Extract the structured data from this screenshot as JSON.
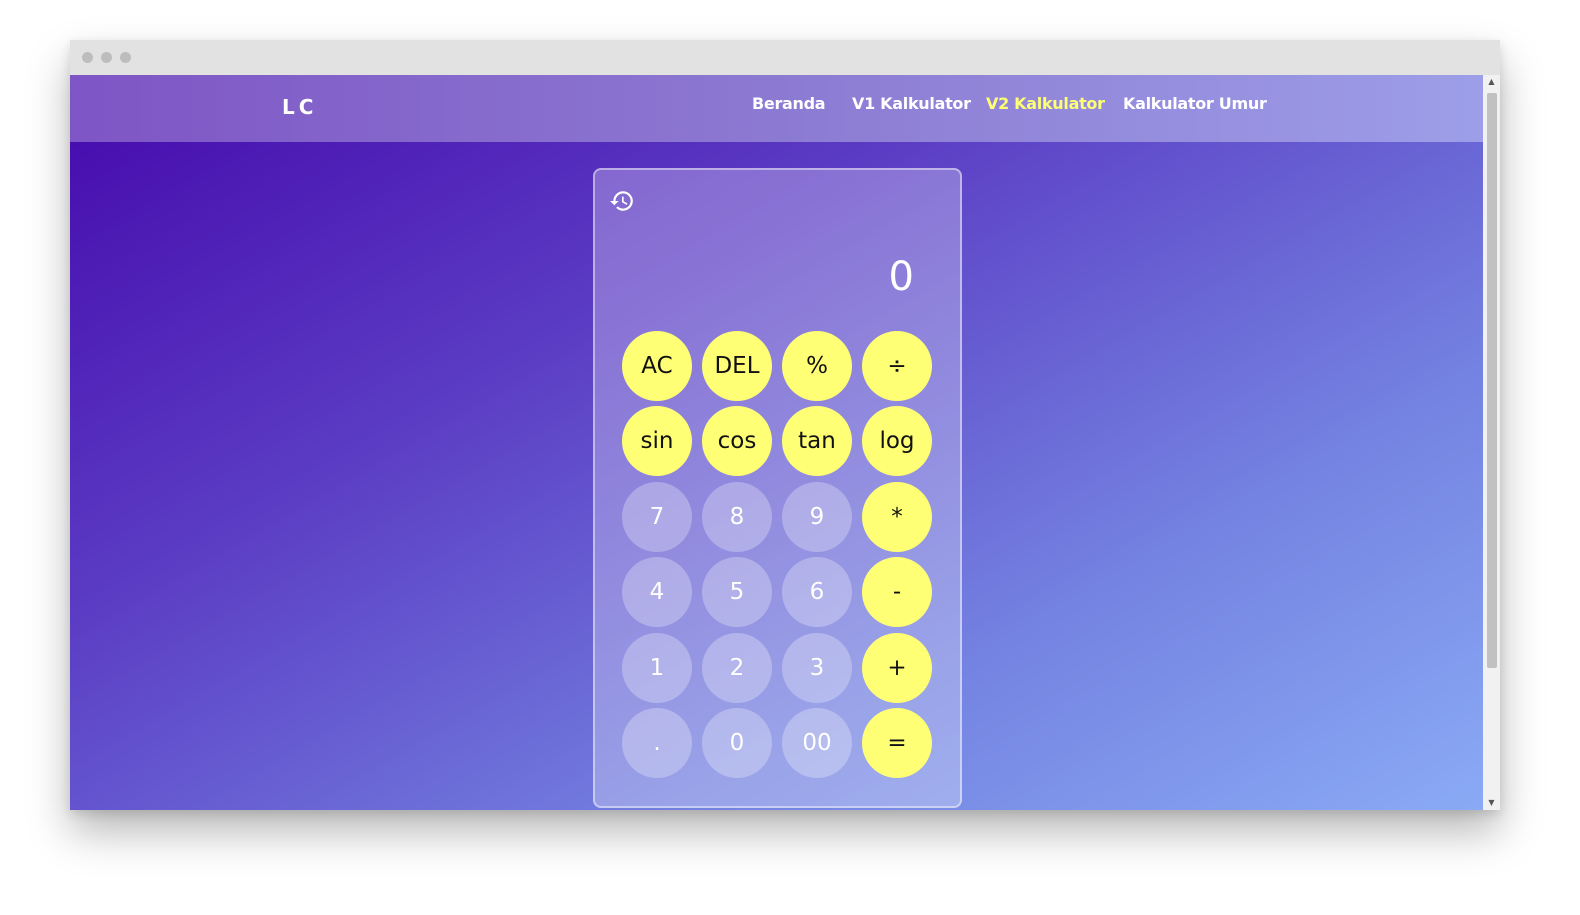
{
  "nav": {
    "logo": "LC",
    "links": [
      {
        "label": "Beranda",
        "active": false
      },
      {
        "label": "V1 Kalkulator",
        "active": false
      },
      {
        "label": "V2 Kalkulator",
        "active": true
      },
      {
        "label": "Kalkulator Umur",
        "active": false
      }
    ]
  },
  "calculator": {
    "display": "0",
    "history_icon": "history-icon",
    "keys": [
      [
        "AC",
        "DEL",
        "%",
        "÷"
      ],
      [
        "sin",
        "cos",
        "tan",
        "log"
      ],
      [
        "7",
        "8",
        "9",
        "*"
      ],
      [
        "4",
        "5",
        "6",
        "-"
      ],
      [
        "1",
        "2",
        "3",
        "+"
      ],
      [
        ".",
        "0",
        "00",
        "="
      ]
    ]
  },
  "colors": {
    "accent_yellow": "#ffff75",
    "active_link": "#ffff73",
    "gradient_start": "#4508ac",
    "gradient_end": "#8aaaf5"
  }
}
